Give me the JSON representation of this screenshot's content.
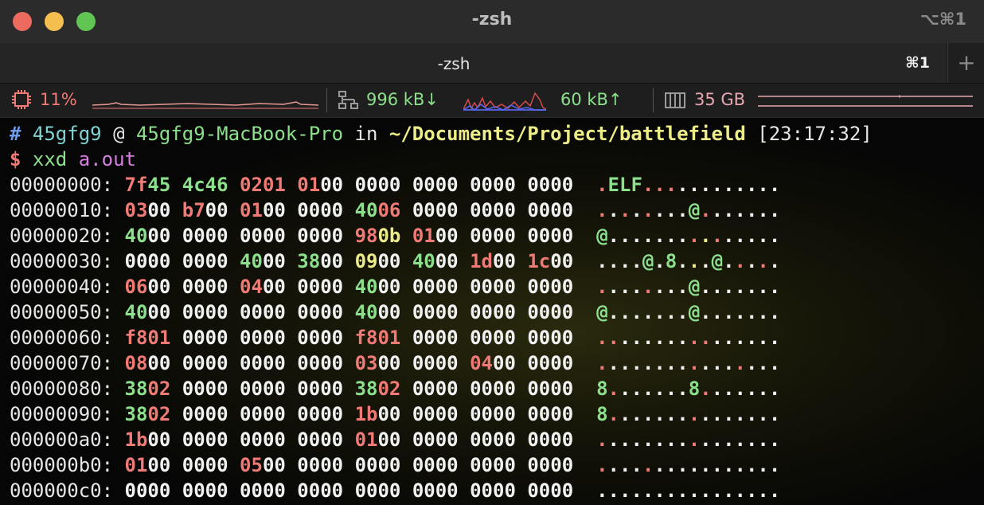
{
  "window": {
    "title": "-zsh",
    "shortcut": "⌥⌘1",
    "tab": {
      "label": "-zsh",
      "shortcut": "⌘1"
    },
    "new_tab": "+"
  },
  "status": {
    "cpu": "11%",
    "net_down": "996 kB↓",
    "net_up": "60 kB↑",
    "mem": "35 GB"
  },
  "prompt": {
    "hash": "#",
    "user": "45gfg9",
    "at": "@",
    "host": "45gfg9-MacBook-Pro",
    "in": "in",
    "path": "~/Documents/Project/battlefield",
    "time": "[23:17:32]",
    "dollar": "$",
    "cmd": "xxd",
    "arg": "a.out"
  },
  "colors": {
    "nonzero": "#f07a75",
    "printable": "#8ce08c",
    "whitespace": "#ecec8a",
    "zero": "#f2f2f2",
    "path": "#ecec8a",
    "user": "#7fd3d3",
    "host": "#8ce08c",
    "command": "#8ce08c",
    "argument": "#d77fe0"
  },
  "hexdump": [
    {
      "offset": "00000000:",
      "hex": "7f45 4c46 0201 0100 0000 0000 0000 0000",
      "ascii": ".ELF............"
    },
    {
      "offset": "00000010:",
      "hex": "0300 b700 0100 0000 4006 0000 0000 0000",
      "ascii": "........@......."
    },
    {
      "offset": "00000020:",
      "hex": "4000 0000 0000 0000 980b 0100 0000 0000",
      "ascii": "@..............."
    },
    {
      "offset": "00000030:",
      "hex": "0000 0000 4000 3800 0900 4000 1d00 1c00",
      "ascii": "....@.8...@....."
    },
    {
      "offset": "00000040:",
      "hex": "0600 0000 0400 0000 4000 0000 0000 0000",
      "ascii": "........@......."
    },
    {
      "offset": "00000050:",
      "hex": "4000 0000 0000 0000 4000 0000 0000 0000",
      "ascii": "@.......@......."
    },
    {
      "offset": "00000060:",
      "hex": "f801 0000 0000 0000 f801 0000 0000 0000",
      "ascii": "................"
    },
    {
      "offset": "00000070:",
      "hex": "0800 0000 0000 0000 0300 0000 0400 0000",
      "ascii": "................"
    },
    {
      "offset": "00000080:",
      "hex": "3802 0000 0000 0000 3802 0000 0000 0000",
      "ascii": "8.......8......."
    },
    {
      "offset": "00000090:",
      "hex": "3802 0000 0000 0000 1b00 0000 0000 0000",
      "ascii": "8..............."
    },
    {
      "offset": "000000a0:",
      "hex": "1b00 0000 0000 0000 0100 0000 0000 0000",
      "ascii": "................"
    },
    {
      "offset": "000000b0:",
      "hex": "0100 0000 0500 0000 0000 0000 0000 0000",
      "ascii": "................"
    },
    {
      "offset": "000000c0:",
      "hex": "0000 0000 0000 0000 0000 0000 0000 0000",
      "ascii": "................"
    }
  ]
}
